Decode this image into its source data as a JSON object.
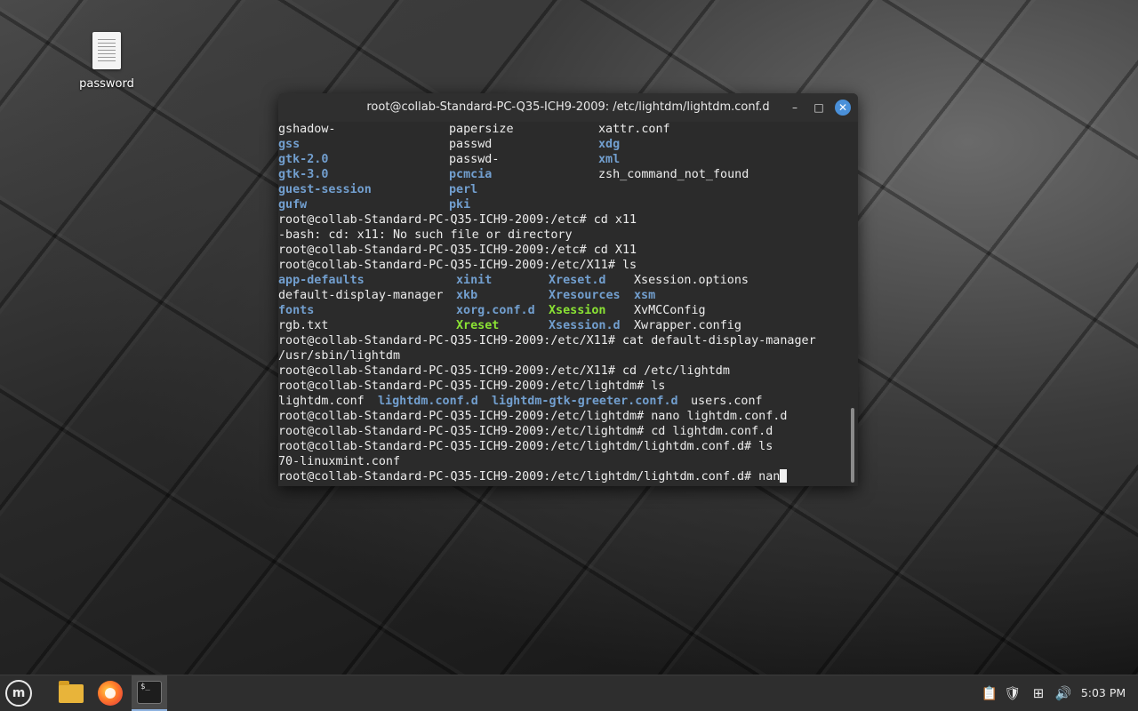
{
  "desktop": {
    "icon_label": "password"
  },
  "terminal": {
    "title": "root@collab-Standard-PC-Q35-ICH9-2009: /etc/lightdm/lightdm.conf.d",
    "buttons": {
      "minimize": "–",
      "maximize": "□",
      "close": "✕"
    },
    "lines": [
      [
        {
          "t": "gshadow-",
          "c": "txt"
        },
        {
          "t": "papersize",
          "c": "txt",
          "col": 1
        },
        {
          "t": "xattr.conf",
          "c": "txt",
          "col": 2
        }
      ],
      [
        {
          "t": "gss",
          "c": "dir"
        },
        {
          "t": "passwd",
          "c": "txt",
          "col": 1
        },
        {
          "t": "xdg",
          "c": "dir",
          "col": 2
        }
      ],
      [
        {
          "t": "gtk-2.0",
          "c": "dir"
        },
        {
          "t": "passwd-",
          "c": "txt",
          "col": 1
        },
        {
          "t": "xml",
          "c": "dir",
          "col": 2
        }
      ],
      [
        {
          "t": "gtk-3.0",
          "c": "dir"
        },
        {
          "t": "pcmcia",
          "c": "dir",
          "col": 1
        },
        {
          "t": "zsh_command_not_found",
          "c": "txt",
          "col": 2
        }
      ],
      [
        {
          "t": "guest-session",
          "c": "dir"
        },
        {
          "t": "perl",
          "c": "dir",
          "col": 1
        }
      ],
      [
        {
          "t": "gufw",
          "c": "dir"
        },
        {
          "t": "pki",
          "c": "dir",
          "col": 1
        }
      ],
      [
        {
          "t": "root@collab-Standard-PC-Q35-ICH9-2009:/etc# cd x11",
          "c": "txt"
        }
      ],
      [
        {
          "t": "-bash: cd: x11: No such file or directory",
          "c": "txt"
        }
      ],
      [
        {
          "t": "root@collab-Standard-PC-Q35-ICH9-2009:/etc# cd X11",
          "c": "txt"
        }
      ],
      [
        {
          "t": "root@collab-Standard-PC-Q35-ICH9-2009:/etc/X11# ls",
          "c": "txt"
        }
      ],
      [
        {
          "t": "app-defaults",
          "c": "dir"
        },
        {
          "t": "xinit",
          "c": "dir",
          "col": 3
        },
        {
          "t": "Xreset.d",
          "c": "dir",
          "col": 4
        },
        {
          "t": "Xsession.options",
          "c": "txt",
          "col": 5
        }
      ],
      [
        {
          "t": "default-display-manager",
          "c": "txt"
        },
        {
          "t": "xkb",
          "c": "dir",
          "col": 3
        },
        {
          "t": "Xresources",
          "c": "dir",
          "col": 4
        },
        {
          "t": "xsm",
          "c": "dir",
          "col": 5
        }
      ],
      [
        {
          "t": "fonts",
          "c": "dir"
        },
        {
          "t": "xorg.conf.d",
          "c": "dir",
          "col": 3
        },
        {
          "t": "Xsession",
          "c": "exe",
          "col": 4
        },
        {
          "t": "XvMCConfig",
          "c": "txt",
          "col": 5
        }
      ],
      [
        {
          "t": "rgb.txt",
          "c": "txt"
        },
        {
          "t": "Xreset",
          "c": "exe",
          "col": 3
        },
        {
          "t": "Xsession.d",
          "c": "dir",
          "col": 4
        },
        {
          "t": "Xwrapper.config",
          "c": "txt",
          "col": 5
        }
      ],
      [
        {
          "t": "root@collab-Standard-PC-Q35-ICH9-2009:/etc/X11# cat default-display-manager",
          "c": "txt"
        }
      ],
      [
        {
          "t": "/usr/sbin/lightdm",
          "c": "txt"
        }
      ],
      [
        {
          "t": "root@collab-Standard-PC-Q35-ICH9-2009:/etc/X11# cd /etc/lightdm",
          "c": "txt"
        }
      ],
      [
        {
          "t": "root@collab-Standard-PC-Q35-ICH9-2009:/etc/lightdm# ls",
          "c": "txt"
        }
      ],
      [
        {
          "t": "lightdm.conf",
          "c": "txt"
        },
        {
          "t": "lightdm.conf.d",
          "c": "dir",
          "col": 6
        },
        {
          "t": "lightdm-gtk-greeter.conf.d",
          "c": "dir",
          "col": 7
        },
        {
          "t": "users.conf",
          "c": "txt",
          "col": 8
        }
      ],
      [
        {
          "t": "root@collab-Standard-PC-Q35-ICH9-2009:/etc/lightdm# nano lightdm.conf.d",
          "c": "txt"
        }
      ],
      [
        {
          "t": "root@collab-Standard-PC-Q35-ICH9-2009:/etc/lightdm# cd lightdm.conf.d",
          "c": "txt"
        }
      ],
      [
        {
          "t": "root@collab-Standard-PC-Q35-ICH9-2009:/etc/lightdm/lightdm.conf.d# ls",
          "c": "txt"
        }
      ],
      [
        {
          "t": "70-linuxmint.conf",
          "c": "txt"
        }
      ],
      [
        {
          "t": "root@collab-Standard-PC-Q35-ICH9-2009:/etc/lightdm/lightdm.conf.d# nan",
          "c": "txt",
          "cursor": true
        }
      ]
    ]
  },
  "taskbar": {
    "menu_glyph": "m",
    "terminal_glyph": "$_",
    "tray_glyphs": {
      "notes": "📋",
      "shield": "🛡",
      "network": "⊞",
      "volume": "🔊"
    },
    "clock": "5:03 PM"
  }
}
